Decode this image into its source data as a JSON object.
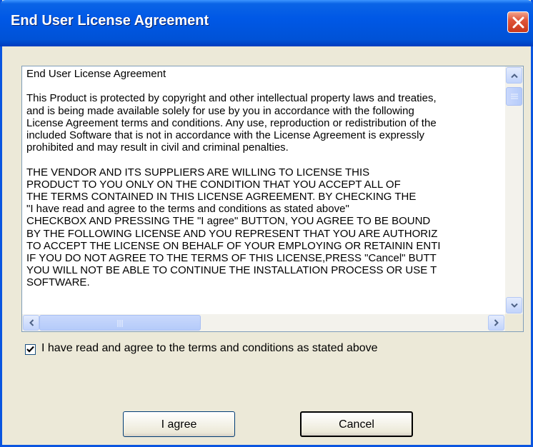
{
  "window": {
    "title": "End User License Agreement",
    "close_icon": "close-icon",
    "accent_color": "#0058e6",
    "close_color": "#e0553a"
  },
  "license": {
    "paragraphs": [
      [
        "End User License Agreement"
      ],
      [
        "This Product is protected by copyright and other intellectual property laws and treaties,",
        "and is being made available solely for use by you in accordance with the following",
        "License Agreement terms and conditions. Any use, reproduction or redistribution of the",
        "included Software that is not in accordance with the License Agreement is expressly",
        "prohibited and may result in civil and criminal penalties."
      ],
      [
        "THE VENDOR AND ITS SUPPLIERS ARE WILLING TO LICENSE THIS",
        "PRODUCT TO YOU ONLY ON THE CONDITION THAT YOU ACCEPT ALL OF",
        "THE TERMS CONTAINED IN THIS LICENSE AGREEMENT. BY CHECKING THE",
        "\"I have read and agree to the terms and conditions as stated above\"",
        "CHECKBOX AND PRESSING THE \"I agree\" BUTTON, YOU AGREE TO BE BOUND",
        "BY THE FOLLOWING LICENSE AND YOU REPRESENT THAT YOU ARE AUTHORIZ",
        "TO ACCEPT THE LICENSE ON BEHALF OF YOUR EMPLOYING OR RETAININ ENTI",
        "IF YOU DO NOT AGREE TO THE TERMS OF THIS LICENSE,PRESS \"Cancel\" BUTT",
        "YOU WILL NOT BE ABLE TO CONTINUE THE INSTALLATION PROCESS OR USE T",
        "SOFTWARE."
      ]
    ]
  },
  "scrollbars": {
    "vertical_position": 0.02,
    "horizontal_position": 0.0,
    "up_icon": "chevron-up-icon",
    "down_icon": "chevron-down-icon",
    "left_icon": "chevron-left-icon",
    "right_icon": "chevron-right-icon"
  },
  "agreement": {
    "checked": true,
    "label": "I have read and agree to the terms and conditions as stated above"
  },
  "buttons": {
    "agree_label": "I agree",
    "cancel_label": "Cancel"
  }
}
